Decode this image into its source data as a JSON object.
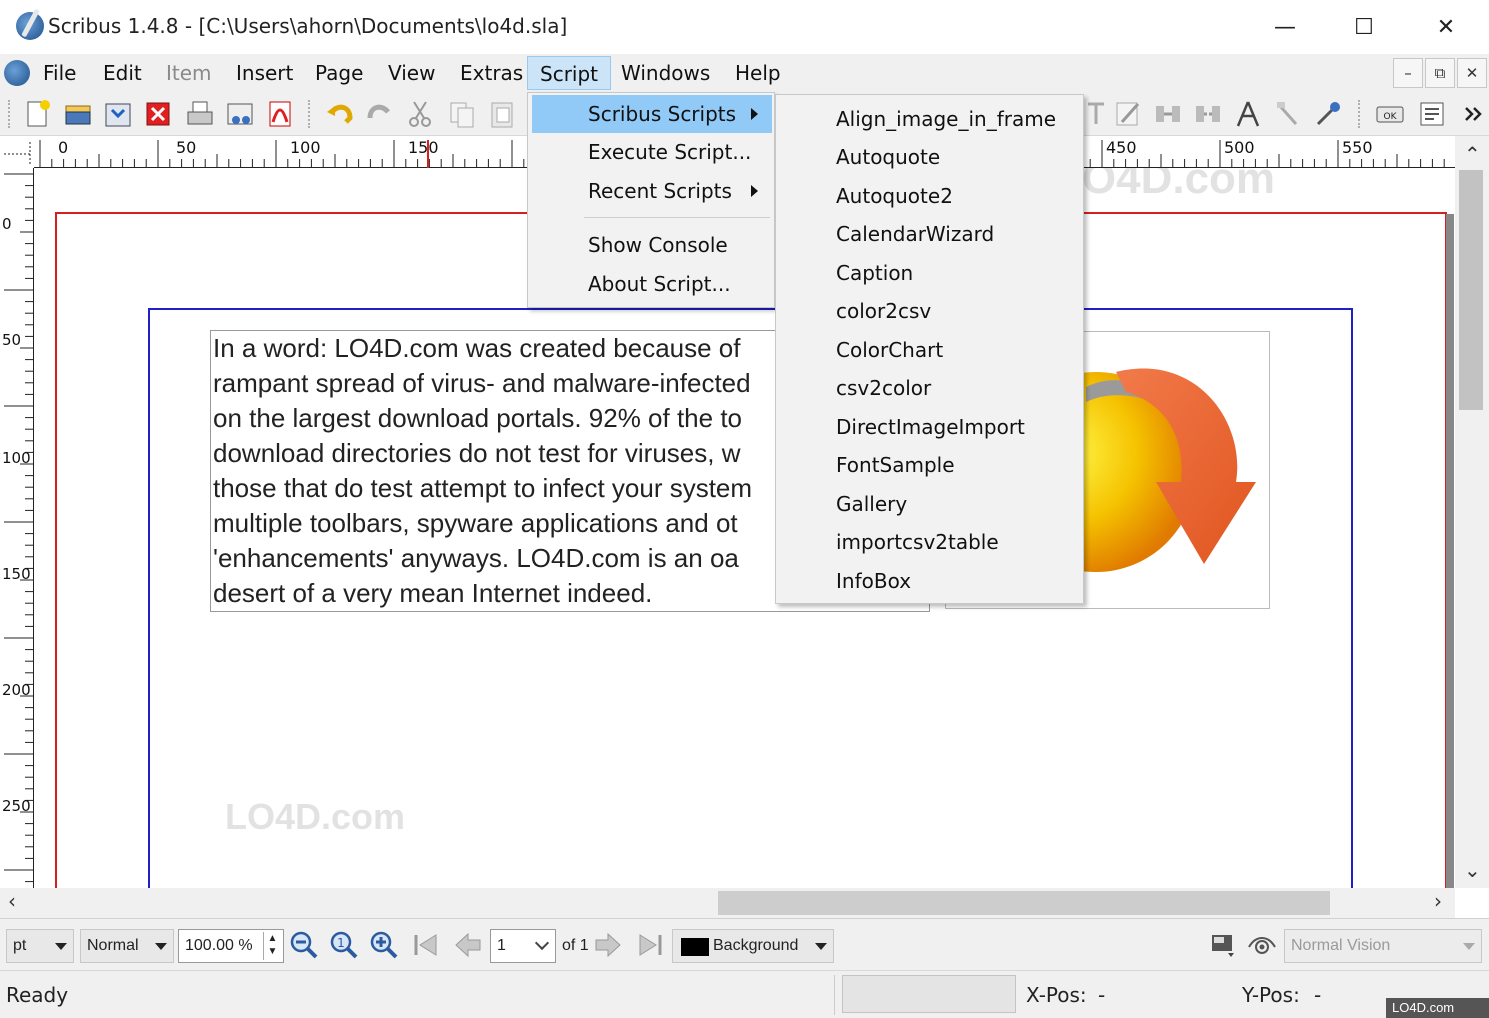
{
  "window": {
    "title": "Scribus 1.4.8 - [C:\\Users\\ahorn\\Documents\\lo4d.sla]",
    "minimize": "—",
    "maximize": "☐",
    "close": "✕"
  },
  "menubar": {
    "items": [
      "File",
      "Edit",
      "Item",
      "Insert",
      "Page",
      "View",
      "Extras",
      "Script",
      "Windows",
      "Help"
    ],
    "mdi": [
      "–",
      "⧉",
      "✕"
    ]
  },
  "script_menu": {
    "items": [
      {
        "label": "Scribus Scripts"
      },
      {
        "label": "Execute Script..."
      },
      {
        "label": "Recent Scripts"
      },
      {
        "label": "Show Console"
      },
      {
        "label": "About Script..."
      }
    ]
  },
  "scripts_submenu": {
    "items": [
      "Align_image_in_frame",
      "Autoquote",
      "Autoquote2",
      "CalendarWizard",
      "Caption",
      "color2csv",
      "ColorChart",
      "csv2color",
      "DirectImageImport",
      "FontSample",
      "Gallery",
      "importcsv2table",
      "InfoBox"
    ]
  },
  "ruler": {
    "h_labels": [
      "0",
      "50",
      "100",
      "150",
      "450",
      "500",
      "550"
    ],
    "v_labels": [
      "0",
      "50",
      "100",
      "150",
      "200",
      "250"
    ]
  },
  "document": {
    "text": "In a word: LO4D.com was created because of\nrampant spread of virus- and malware-infected\non the largest download portals. 92% of the to\ndownload directories do not test for viruses, w\nthose that do test attempt to infect your system\nmultiple toolbars, spyware applications and ot\n'enhancements' anyways. LO4D.com is an oa\ndesert of a very mean Internet indeed."
  },
  "bottombar": {
    "unit": "pt",
    "image_mode": "Normal",
    "zoom": "100.00 %",
    "page_number": "1",
    "page_of": "of 1",
    "layer": "Background",
    "vision": "Normal Vision"
  },
  "statusbar": {
    "status": "Ready",
    "xpos_label": "X-Pos:",
    "xpos_value": "-",
    "ypos_label": "Y-Pos:",
    "ypos_value": "-"
  },
  "watermark": {
    "main": "LO4D.com",
    "corner": "LO4D.com"
  },
  "colors": {
    "page_border": "#d42020",
    "margin_guide": "#2020c8",
    "menu_highlight": "#91c9f7",
    "menubar_active": "#cce4f7"
  },
  "icons": {
    "toolbar_left": [
      "new-document-icon",
      "open-icon",
      "save-icon",
      "close-document-icon",
      "print-icon",
      "preflight-icon",
      "export-pdf-icon",
      "undo-icon",
      "redo-icon",
      "cut-icon",
      "copy-icon",
      "paste-icon"
    ],
    "toolbar_right": [
      "text-icon",
      "edit-text-icon",
      "link-frames-icon",
      "unlink-frames-icon",
      "measure-icon",
      "eyedropper-icon",
      "copy-properties-icon",
      "ok-icon",
      "pdf-field-icon",
      "more-icon"
    ]
  }
}
